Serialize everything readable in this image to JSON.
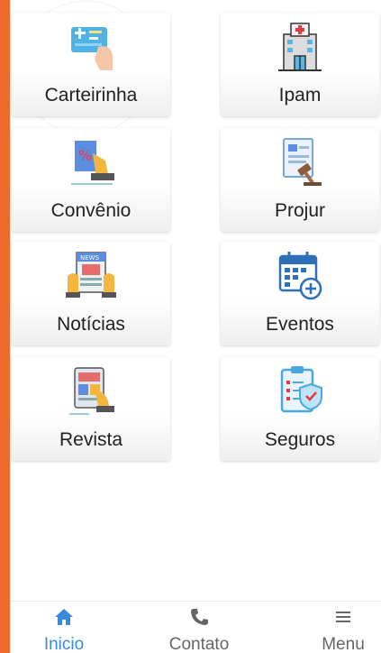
{
  "colors": {
    "accent": "#f06a2c",
    "active_tab": "#3b8ad9",
    "inactive_tab": "#666666"
  },
  "menu": [
    {
      "label": "Carteirinha",
      "icon": "id-card-icon"
    },
    {
      "label": "Ipam",
      "icon": "hospital-building-icon"
    },
    {
      "label": "Convênio",
      "icon": "discount-voucher-icon"
    },
    {
      "label": "Projur",
      "icon": "legal-document-gavel-icon"
    },
    {
      "label": "Notícias",
      "icon": "newspaper-icon"
    },
    {
      "label": "Eventos",
      "icon": "calendar-add-icon"
    },
    {
      "label": "Revista",
      "icon": "magazine-tablet-icon"
    },
    {
      "label": "Seguros",
      "icon": "insurance-clipboard-shield-icon"
    }
  ],
  "tabbar": {
    "tabs": [
      {
        "label": "Inicio",
        "icon": "home-icon",
        "active": true
      },
      {
        "label": "Contato",
        "icon": "phone-icon",
        "active": false
      },
      {
        "label": "Menu",
        "icon": "hamburger-menu-icon",
        "active": false
      }
    ]
  }
}
